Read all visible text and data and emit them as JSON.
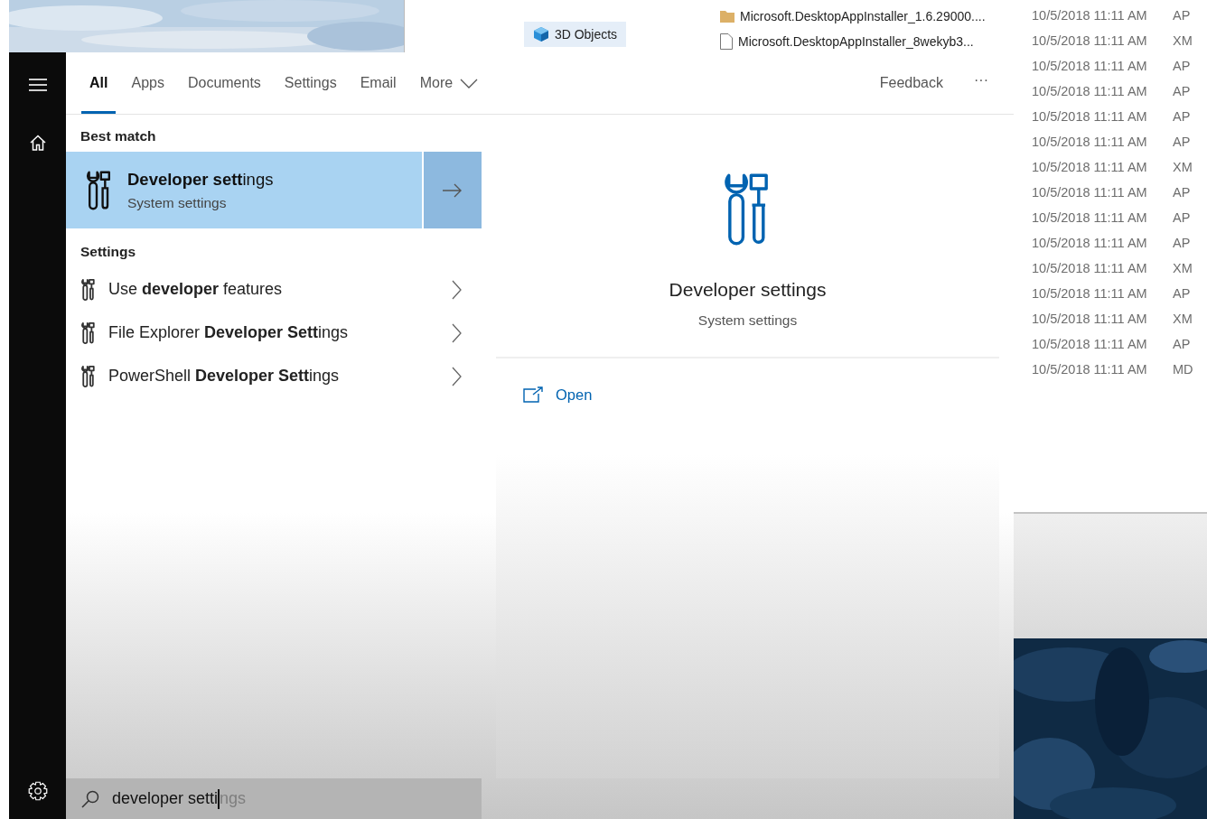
{
  "background_window": {
    "nav_items": [
      {
        "label": "3D Objects",
        "selected": true
      }
    ],
    "files": [
      {
        "name": "Microsoft.DesktopAppInstaller_1.6.29000....",
        "kind": "folder"
      },
      {
        "name": "Microsoft.DesktopAppInstaller_8wekyb3...",
        "kind": "file"
      }
    ],
    "rows": [
      {
        "date": "10/5/2018 11:11 AM",
        "type": "AP"
      },
      {
        "date": "10/5/2018 11:11 AM",
        "type": "XM"
      },
      {
        "date": "10/5/2018 11:11 AM",
        "type": "AP"
      },
      {
        "date": "10/5/2018 11:11 AM",
        "type": "AP"
      },
      {
        "date": "10/5/2018 11:11 AM",
        "type": "AP"
      },
      {
        "date": "10/5/2018 11:11 AM",
        "type": "AP"
      },
      {
        "date": "10/5/2018 11:11 AM",
        "type": "XM"
      },
      {
        "date": "10/5/2018 11:11 AM",
        "type": "AP"
      },
      {
        "date": "10/5/2018 11:11 AM",
        "type": "AP"
      },
      {
        "date": "10/5/2018 11:11 AM",
        "type": "AP"
      },
      {
        "date": "10/5/2018 11:11 AM",
        "type": "XM"
      },
      {
        "date": "10/5/2018 11:11 AM",
        "type": "AP"
      },
      {
        "date": "10/5/2018 11:11 AM",
        "type": "XM"
      },
      {
        "date": "10/5/2018 11:11 AM",
        "type": "AP"
      },
      {
        "date": "10/5/2018 11:11 AM",
        "type": "MD"
      }
    ]
  },
  "search_panel": {
    "tabs": [
      {
        "label": "All",
        "selected": true
      },
      {
        "label": "Apps",
        "selected": false
      },
      {
        "label": "Documents",
        "selected": false
      },
      {
        "label": "Settings",
        "selected": false
      },
      {
        "label": "Email",
        "selected": false
      },
      {
        "label": "More",
        "selected": false,
        "kind": "dropdown"
      }
    ],
    "feedback": "Feedback",
    "more_options": "···",
    "best_match_heading": "Best match",
    "best_match": {
      "title": "**Developer sett**ings",
      "subtitle": "System settings",
      "selected": true
    },
    "settings_heading": "Settings",
    "settings_results": [
      {
        "title": "Use **developer** features"
      },
      {
        "title": "File Explorer **Developer Sett**ings"
      },
      {
        "title": "PowerShell **Developer Sett**ings"
      }
    ],
    "preview": {
      "title": "Developer settings",
      "subtitle": "System settings",
      "actions": [
        {
          "label": "Open"
        }
      ]
    },
    "search_box": {
      "value": "developer setti",
      "suggestion": "ngs"
    }
  }
}
